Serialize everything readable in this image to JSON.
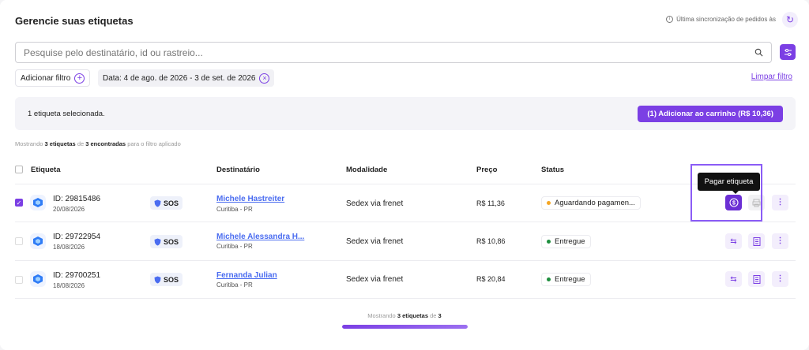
{
  "header": {
    "title": "Gerencie suas etiquetas",
    "sync_text": "Última sincronização de pedidos às"
  },
  "search": {
    "placeholder": "Pesquise pelo destinatário, id ou rastreio..."
  },
  "filters": {
    "add_label": "Adicionar filtro",
    "date_chip": "Data: 4 de ago. de 2026 - 3 de set. de 2026",
    "clear_label": "Limpar filtro"
  },
  "selection": {
    "text": "1 etiqueta selecionada.",
    "cart_button": "(1) Adicionar ao carrinho (R$ 10,36)"
  },
  "summary": {
    "prefix": "Mostrando",
    "shown": "3 etiquetas",
    "mid": "de",
    "found": "3 encontradas",
    "suffix": "para o filtro aplicado"
  },
  "table": {
    "headers": {
      "etiqueta": "Etiqueta",
      "destinatario": "Destinatário",
      "modalidade": "Modalidade",
      "preco": "Preço",
      "status": "Status"
    },
    "rows": [
      {
        "id": "ID: 29815486",
        "date": "20/08/2026",
        "badge": "SOS",
        "name": "Michele Hastreiter",
        "city": "Curitiba - PR",
        "modalidade": "Sedex via frenet",
        "preco": "R$ 11,36",
        "status": "Aguardando pagamen...",
        "status_color": "#f5a623",
        "checked": true
      },
      {
        "id": "ID: 29722954",
        "date": "18/08/2026",
        "badge": "SOS",
        "name": "Michele Alessandra H...",
        "city": "Curitiba - PR",
        "modalidade": "Sedex via frenet",
        "preco": "R$ 10,86",
        "status": "Entregue",
        "status_color": "#1e8e3e",
        "checked": false
      },
      {
        "id": "ID: 29700251",
        "date": "18/08/2026",
        "badge": "SOS",
        "name": "Fernanda Julian",
        "city": "Curitiba - PR",
        "modalidade": "Sedex via frenet",
        "preco": "R$ 20,84",
        "status": "Entregue",
        "status_color": "#1e8e3e",
        "checked": false
      }
    ]
  },
  "tooltip": "Pagar etiqueta",
  "footer": {
    "prefix": "Mostrando",
    "shown": "3 etiquetas",
    "mid": "de",
    "total": "3",
    "progress": 1.0
  },
  "colors": {
    "accent": "#7b3fe4",
    "link": "#4a6cf0"
  }
}
